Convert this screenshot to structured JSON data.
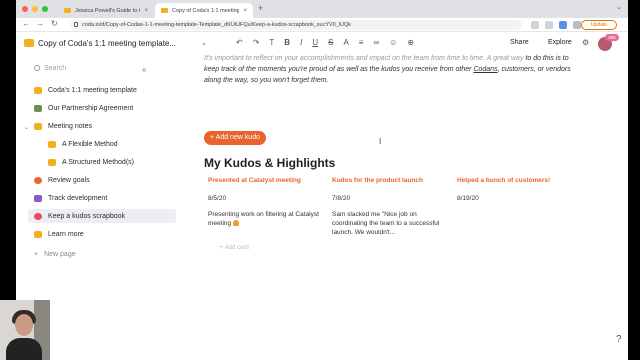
{
  "browser": {
    "tabs": [
      {
        "title": "Jessica Powell's Guide to Grow"
      },
      {
        "title": "Copy of Coda's 1:1 meeting template"
      }
    ],
    "tab_close": "×",
    "new_tab": "+",
    "url": "coda.io/d/Copy-of-Codas-1-1-meeting-template-Template_dKUiUFQu/Keep-a-kudos-scrapbook_sucYVII_lUQk",
    "update_label": "Update"
  },
  "toolbar": {
    "doc_title": "Copy of Coda's 1:1 meeting template...",
    "share_label": "Share",
    "explore_label": "Explore",
    "avatar_badge": "365"
  },
  "sidebar": {
    "search_placeholder": "Search",
    "collapse": "«",
    "items": [
      {
        "label": "Coda's 1:1 meeting template",
        "color": "#f2b01e"
      },
      {
        "label": "Our Partnership Agreement",
        "color": "#6b8e5a"
      },
      {
        "label": "Meeting notes",
        "color": "#f2b01e"
      },
      {
        "label": "A Flexible Method",
        "color": "#f2b01e"
      },
      {
        "label": "A Structured Method(s)",
        "color": "#f2b01e"
      },
      {
        "label": "Review goals",
        "color": "#e8642c"
      },
      {
        "label": "Track development",
        "color": "#8a5cc7"
      },
      {
        "label": "Keep a kudos scrapbook",
        "color": "#e8495c"
      },
      {
        "label": "Learn more",
        "color": "#f2b01e"
      }
    ],
    "new_page": "New page"
  },
  "main": {
    "intro_muted": "It's important to reflect on your accomplishments and impact on the team from time to time. A great way",
    "intro_line2": "to do this is to keep track of the moments you're proud of as well as the kudos you receive from other",
    "intro_link": "Codans",
    "intro_line3": ", customers, or vendors along the way, so you won't forget them.",
    "add_button": "+ Add new kudo",
    "heading": "My Kudos & Highlights",
    "cards": [
      {
        "title": "Presented at Catalyst meeting",
        "date": "8/5/20",
        "text": "Presenting work on filtering at Catalyst meeting"
      },
      {
        "title": "Kudos for the product launch",
        "date": "7/8/20",
        "text": "Sam slacked me \"Nice job on coordinating the team to a successful launch. We wouldn't..."
      },
      {
        "title": "Helped a bunch of customers!",
        "date": "8/19/20",
        "text": ""
      }
    ],
    "add_card": "+ Add card"
  },
  "help": "?"
}
